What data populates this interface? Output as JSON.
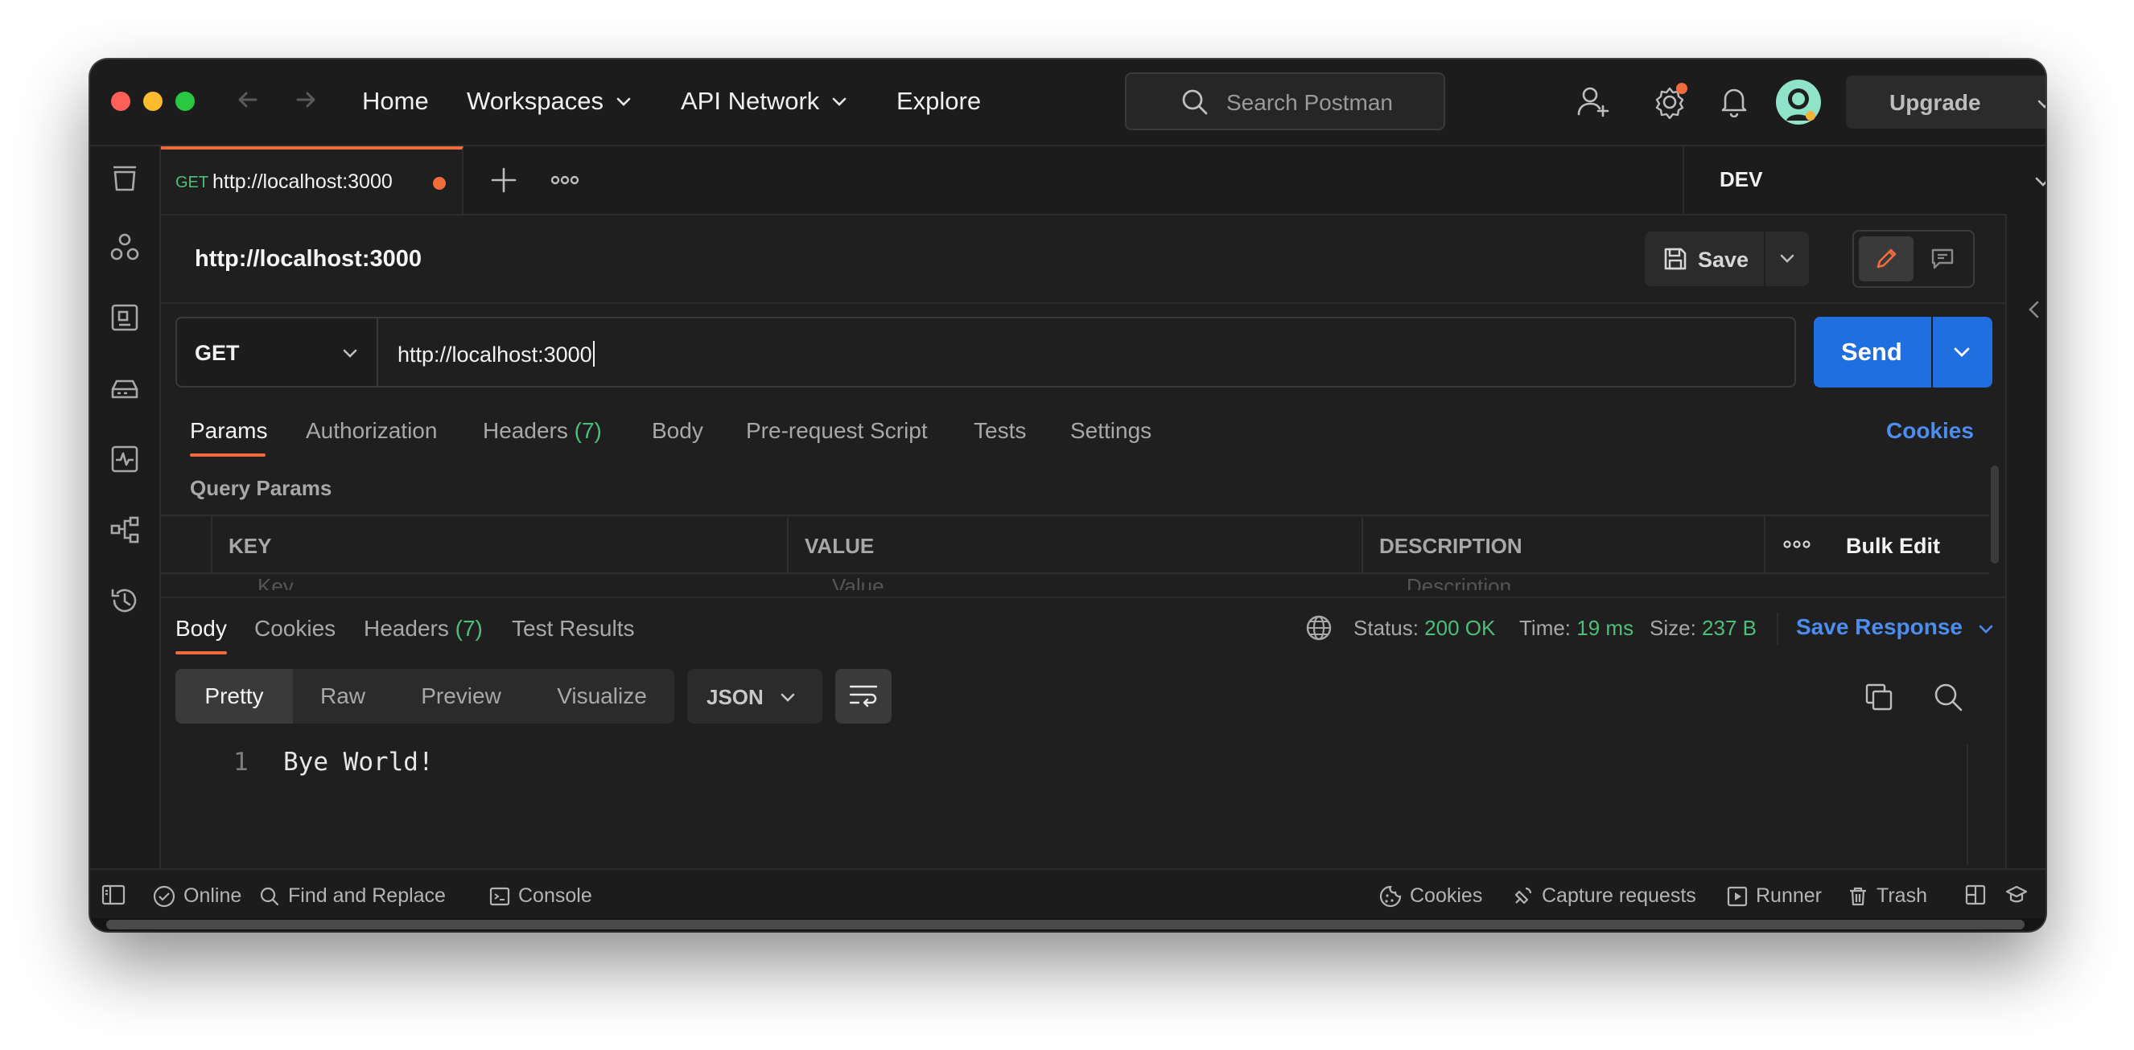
{
  "titlebar": {
    "nav": [
      "Home",
      "Workspaces",
      "API Network",
      "Explore"
    ],
    "search_placeholder": "Search Postman",
    "upgrade_label": "Upgrade"
  },
  "tab": {
    "method": "GET",
    "url": "http://localhost:3000"
  },
  "environment": {
    "name": "DEV"
  },
  "request": {
    "title": "http://localhost:3000",
    "save_label": "Save",
    "method": "GET",
    "url": "http://localhost:3000",
    "send_label": "Send",
    "tabs": {
      "params": "Params",
      "authorization": "Authorization",
      "headers": "Headers",
      "headers_count": "(7)",
      "body": "Body",
      "prerequest": "Pre-request Script",
      "tests": "Tests",
      "settings": "Settings"
    },
    "cookies_link": "Cookies",
    "query_params_title": "Query Params",
    "table_headers": {
      "key": "KEY",
      "value": "VALUE",
      "description": "DESCRIPTION",
      "bulk_edit": "Bulk Edit"
    },
    "ghost_row": {
      "key": "Key",
      "value": "Value",
      "description": "Description"
    }
  },
  "response": {
    "tabs": {
      "body": "Body",
      "cookies": "Cookies",
      "headers": "Headers",
      "headers_count": "(7)",
      "test_results": "Test Results"
    },
    "status_label": "Status:",
    "status_value": "200 OK",
    "time_label": "Time:",
    "time_value": "19 ms",
    "size_label": "Size:",
    "size_value": "237 B",
    "save_response": "Save Response",
    "view_modes": [
      "Pretty",
      "Raw",
      "Preview",
      "Visualize"
    ],
    "format": "JSON",
    "lines": [
      {
        "num": "1",
        "text": "Bye World!"
      }
    ]
  },
  "statusbar": {
    "online": "Online",
    "find_replace": "Find and Replace",
    "console": "Console",
    "cookies": "Cookies",
    "capture": "Capture requests",
    "runner": "Runner",
    "trash": "Trash"
  },
  "colors": {
    "accent": "#f26b3a",
    "primary": "#1f6fe0",
    "link": "#4b8ef0",
    "success": "#4cbf7a",
    "background": "#1f1f1f"
  },
  "icons": {
    "sidebar": [
      "collections-icon",
      "apis-icon",
      "environments-icon",
      "mock-servers-icon",
      "monitors-icon",
      "flows-icon",
      "history-icon"
    ],
    "header": [
      "add-user-icon",
      "settings-icon",
      "bell-icon",
      "avatar-icon"
    ]
  }
}
